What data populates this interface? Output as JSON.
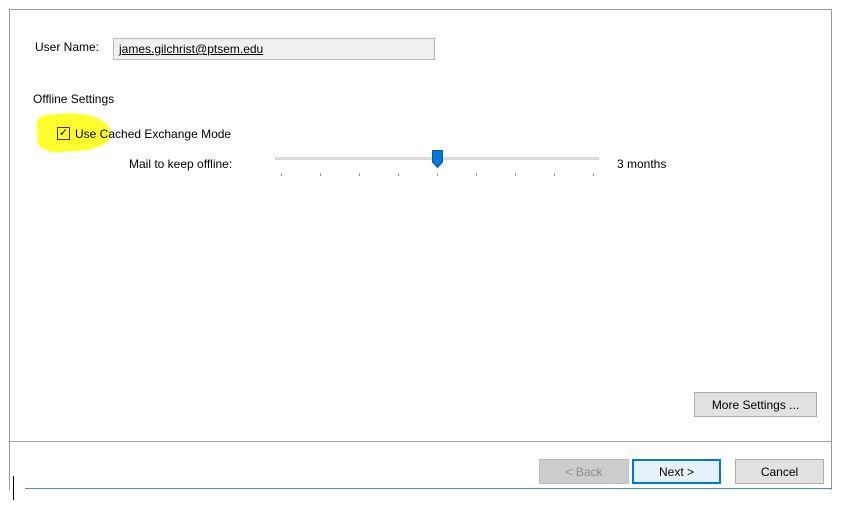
{
  "account": {
    "user_name_label": "User Name:",
    "user_name_value": "james.gilchrist@ptsem.edu"
  },
  "offline_settings": {
    "heading": "Offline Settings",
    "cached_mode": {
      "label": "Use Cached Exchange Mode",
      "checked": true,
      "check_glyph": "✓",
      "highlight_color": "#ffff2e"
    },
    "mail_offline": {
      "label": "Mail to keep offline:",
      "value": "3 months",
      "slider_position": 0.5,
      "tick_count": 9,
      "thumb_color": "#0078d7"
    }
  },
  "buttons": {
    "more_settings": "More Settings ...",
    "back": "< Back",
    "next": "Next >",
    "cancel": "Cancel"
  },
  "colors": {
    "accent": "#0078d7",
    "disabled_text": "#8c8c8c"
  },
  "icons": {
    "checkbox": "check-icon",
    "slider_thumb": "slider-thumb-icon"
  }
}
